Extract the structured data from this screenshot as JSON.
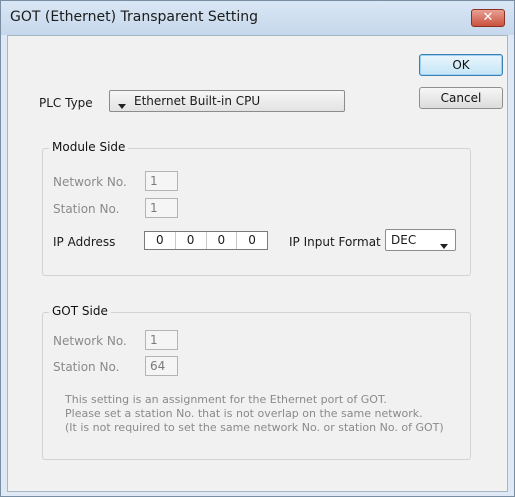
{
  "window": {
    "title": "GOT (Ethernet) Transparent Setting",
    "close_glyph": "✕"
  },
  "buttons": {
    "ok": "OK",
    "cancel": "Cancel"
  },
  "plc_type": {
    "label": "PLC Type",
    "value": "Ethernet Built-in CPU"
  },
  "module_side": {
    "title": "Module Side",
    "network_no_label": "Network No.",
    "network_no_value": "1",
    "station_no_label": "Station No.",
    "station_no_value": "1",
    "ip_address_label": "IP Address",
    "ip_octets": [
      "0",
      "0",
      "0",
      "0"
    ],
    "ip_input_format_label": "IP Input Format",
    "ip_input_format_value": "DEC"
  },
  "got_side": {
    "title": "GOT Side",
    "network_no_label": "Network No.",
    "network_no_value": "1",
    "station_no_label": "Station No.",
    "station_no_value": "64",
    "note_lines": [
      "This setting is an assignment for the Ethernet port of GOT.",
      "Please set a station No. that is not overlap on the same network.",
      "(It is not required to set the same network No. or station No. of GOT)"
    ]
  }
}
